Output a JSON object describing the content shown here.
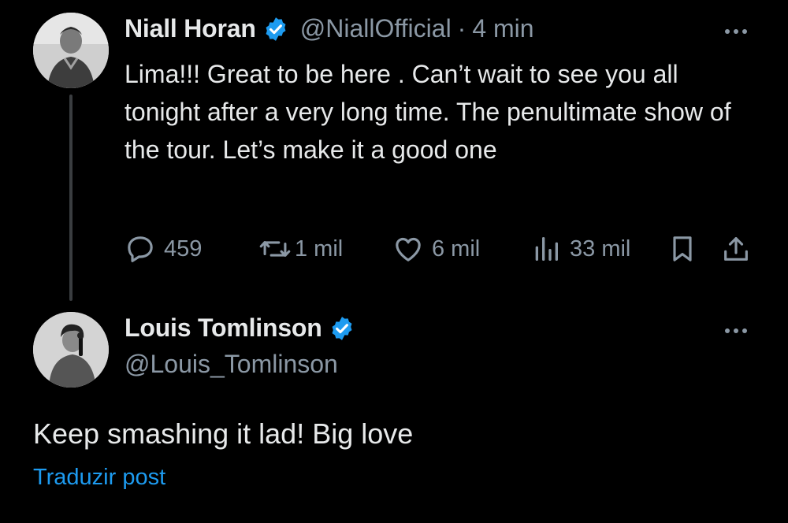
{
  "tweet": {
    "author": {
      "name": "Niall Horan",
      "handle": "@NiallOfficial",
      "verified": true,
      "avatar_icon": "user-photo-icon"
    },
    "separator": "·",
    "time": "4 min",
    "text": "Lima!!! Great to be here . Can’t wait to see you all tonight after a very long time. The penultimate show of the tour. Let’s make it a good one",
    "stats": {
      "replies": "459",
      "reposts": "1 mil",
      "likes": "6 mil",
      "views": "33 mil"
    }
  },
  "reply": {
    "author": {
      "name": "Louis Tomlinson",
      "handle": "@Louis_Tomlinson",
      "verified": true,
      "avatar_icon": "user-photo-icon"
    },
    "text": "Keep smashing it lad! Big love",
    "translate_label": "Traduzir post"
  },
  "colors": {
    "background": "#000000",
    "text_primary": "#e7e9ea",
    "text_secondary": "#8b98a5",
    "accent": "#1d9bf0",
    "thread_line": "#3a3d40"
  }
}
